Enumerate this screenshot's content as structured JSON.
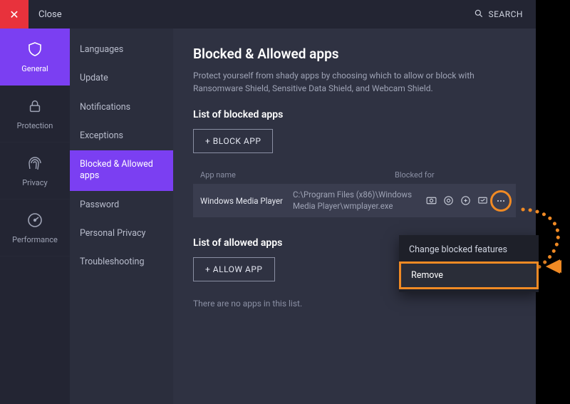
{
  "titlebar": {
    "close_label": "Close",
    "search_label": "SEARCH"
  },
  "rail": {
    "items": [
      {
        "label": "General"
      },
      {
        "label": "Protection"
      },
      {
        "label": "Privacy"
      },
      {
        "label": "Performance"
      }
    ]
  },
  "subnav": {
    "items": [
      {
        "label": "Languages"
      },
      {
        "label": "Update"
      },
      {
        "label": "Notifications"
      },
      {
        "label": "Exceptions"
      },
      {
        "label": "Blocked & Allowed apps"
      },
      {
        "label": "Password"
      },
      {
        "label": "Personal Privacy"
      },
      {
        "label": "Troubleshooting"
      }
    ]
  },
  "main": {
    "title": "Blocked & Allowed apps",
    "description": "Protect yourself from shady apps by choosing which to allow or block with Ransomware Shield, Sensitive Data Shield, and Webcam Shield.",
    "blocked_heading": "List of blocked apps",
    "block_button": "+ BLOCK APP",
    "col_appname": "App name",
    "col_blockedfor": "Blocked for",
    "row1": {
      "name": "Windows Media Player",
      "path": "C:\\Program Files (x86)\\Windows Media Player\\wmplayer.exe"
    },
    "allowed_heading": "List of allowed apps",
    "allow_button": "+ ALLOW APP",
    "empty_text": "There are no apps in this list."
  },
  "menu": {
    "item1": "Change blocked features",
    "item2": "Remove"
  }
}
